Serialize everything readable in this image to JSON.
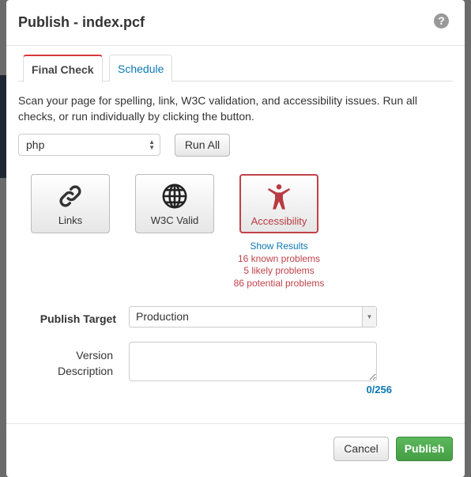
{
  "dialog": {
    "title": "Publish - index.pcf",
    "help_icon": "question-circle-icon"
  },
  "tabs": [
    {
      "label": "Final Check"
    },
    {
      "label": "Schedule"
    }
  ],
  "intro": "Scan your page for spelling, link, W3C validation, and accessibility issues. Run all checks, or run individually by clicking the button.",
  "language_select": {
    "value": "php"
  },
  "run_all_label": "Run All",
  "checks": [
    {
      "label": "Links",
      "icon": "link-icon"
    },
    {
      "label": "W3C Valid",
      "icon": "globe-icon"
    },
    {
      "label": "Accessibility",
      "icon": "accessibility-icon"
    }
  ],
  "accessibility_results": {
    "show": "Show Results",
    "known": "16 known problems",
    "likely": "5 likely problems",
    "potential": "86 potential problems"
  },
  "colors": {
    "error": "#c0424a",
    "link": "#0a78b5",
    "publish": "#5cb85c"
  },
  "form": {
    "target_label": "Publish Target",
    "target_value": "Production",
    "version_label_1": "Version",
    "version_label_2": "Description",
    "version_value": "",
    "char_count": "0/256"
  },
  "footer": {
    "cancel": "Cancel",
    "publish": "Publish"
  }
}
